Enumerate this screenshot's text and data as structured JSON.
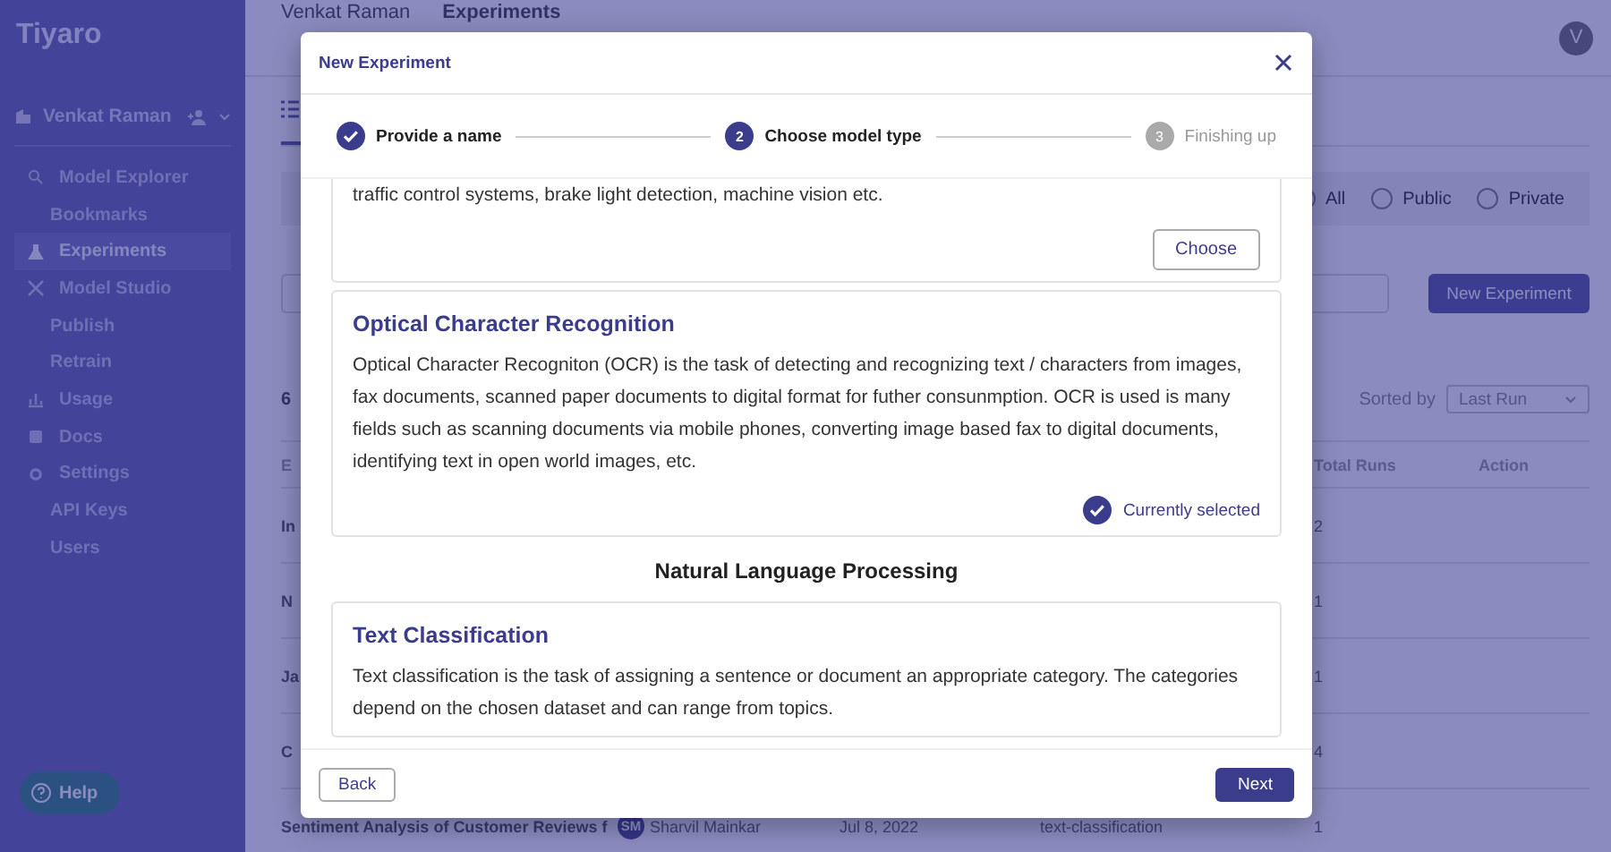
{
  "sidebar": {
    "logo": "Tiyaro",
    "user": "Venkat Raman",
    "items": [
      {
        "label": "Model Explorer",
        "selected": false,
        "children": [
          {
            "label": "Bookmarks",
            "selected": false
          }
        ]
      },
      {
        "label": "Experiments",
        "selected": true
      },
      {
        "label": "Model Studio",
        "selected": false,
        "children": [
          {
            "label": "Publish",
            "selected": false
          },
          {
            "label": "Retrain",
            "selected": false
          }
        ]
      },
      {
        "label": "Usage",
        "selected": false
      },
      {
        "label": "Docs",
        "selected": false
      },
      {
        "label": "Settings",
        "selected": false,
        "children": [
          {
            "label": "API Keys",
            "selected": false
          },
          {
            "label": "Users",
            "selected": false
          }
        ]
      }
    ],
    "help": "Help"
  },
  "header": {
    "breadcrumbs": [
      "Venkat Raman",
      "Experiments"
    ],
    "avatar": "V"
  },
  "filters": [
    {
      "label": "All",
      "selected": false
    },
    {
      "label": "Public",
      "selected": false
    },
    {
      "label": "Private",
      "selected": false
    }
  ],
  "new_button": "New Experiment",
  "count": "6",
  "sort": {
    "label": "Sorted by",
    "value": "Last Run"
  },
  "table": {
    "columns": [
      "E",
      "Total Runs",
      "Action"
    ],
    "rows": [
      {
        "name": "In",
        "runs": "2"
      },
      {
        "name": "N",
        "runs": "1"
      },
      {
        "name": "Ja",
        "runs": "1"
      },
      {
        "name": "C",
        "runs": "4"
      },
      {
        "name": "Sentiment Analysis of Customer Reviews f",
        "owner_initials": "SM",
        "owner": "Sharvil Mainkar",
        "date": "Jul 8, 2022",
        "task": "text-classification",
        "runs": "1"
      }
    ]
  },
  "dialog": {
    "title": "New Experiment",
    "steps": [
      {
        "label": "Provide a name",
        "completed": true,
        "active": false
      },
      {
        "number": "2",
        "label": "Choose model type",
        "completed": false,
        "active": true
      },
      {
        "number": "3",
        "label": "Finishing up",
        "completed": false,
        "active": false
      }
    ],
    "sections": [
      {
        "kind": "card",
        "description": "traffic control systems, brake light detection, machine vision etc.",
        "selected": false,
        "action": "Choose"
      },
      {
        "kind": "card",
        "title": "Optical Character Recognition",
        "description": "Optical Character Recogniton (OCR) is the task of detecting and recognizing text / characters from images, fax documents, scanned paper documents to digital format for futher consunmption. OCR is used is many fields such as scanning documents via mobile phones, converting image based fax to digital documents, identifying text in open world images, etc.",
        "selected": true,
        "action": "Currently selected"
      },
      {
        "kind": "heading",
        "title": "Natural Language Processing"
      },
      {
        "kind": "card",
        "title": "Text Classification",
        "description": "Text classification is the task of assigning a sentence or document an appropriate category. The categories depend on the chosen dataset and can range from topics."
      }
    ],
    "back": "Back",
    "next": "Next"
  }
}
